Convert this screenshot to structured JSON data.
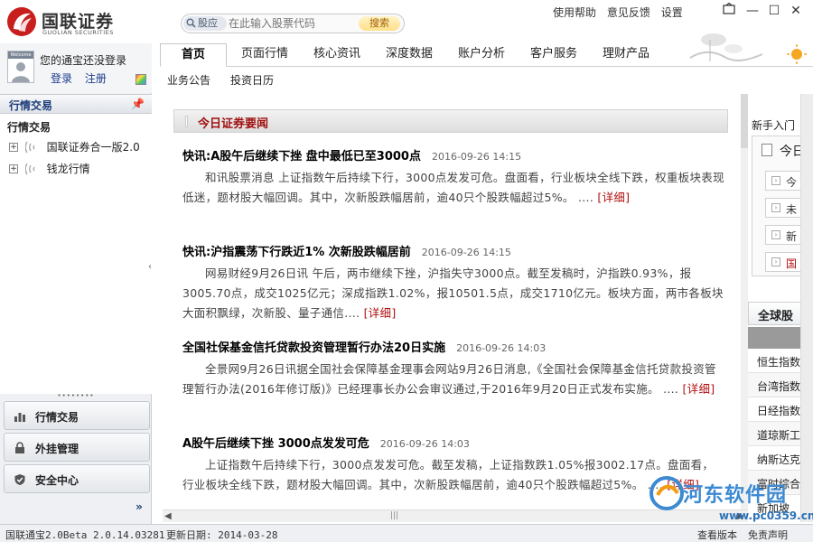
{
  "app": {
    "logo_name": "国联证券",
    "logo_sub": "GUOLIAN SECURITIES"
  },
  "search": {
    "type_label": "股应",
    "placeholder": "在此输入股票代码",
    "button_label": "搜索"
  },
  "top_links": [
    "使用帮助",
    "意见反馈",
    "设置"
  ],
  "window_controls": {
    "minimize": "—",
    "maximize": "☐",
    "close": "✕"
  },
  "user": {
    "avatar_text": "Welcome",
    "message": "您的通宝还没登录",
    "login": "登录",
    "register": "注册"
  },
  "left_panel": {
    "header": "行情交易",
    "tree_title": "行情交易",
    "tree_items": [
      {
        "label": "国联证券合一版2.0",
        "expander": "+"
      },
      {
        "label": "钱龙行情",
        "expander": "+"
      }
    ],
    "nav_buttons": [
      {
        "label": "行情交易",
        "icon": "bar-chart-icon"
      },
      {
        "label": "外挂管理",
        "icon": "lock-icon"
      },
      {
        "label": "安全中心",
        "icon": "shield-check-icon"
      }
    ],
    "more": "»"
  },
  "tabs": [
    "首页",
    "页面行情",
    "核心资讯",
    "深度数据",
    "账户分析",
    "客户服务",
    "理财产品"
  ],
  "active_tab": 0,
  "subtabs": [
    "业务公告",
    "投资日历"
  ],
  "section_title": "今日证券要闻",
  "news": [
    {
      "title": "快讯:A股午后继续下挫  盘中最低已至3000点",
      "time": "2016-09-26 14:15",
      "body": "和讯股票消息 上证指数午后持续下行，3000点发发可危。盘面看，行业板块全线下跌，权重板块表现低迷，题材股大幅回调。其中，次新股跌幅居前，逾40只个股跌幅超过5%。 ....",
      "more": "[详细]"
    },
    {
      "title": "快讯:沪指震荡下行跌近1% 次新股跌幅居前",
      "time": "2016-09-26 14:15",
      "body": "网易财经9月26日讯 午后，两市继续下挫，沪指失守3000点。截至发稿时，沪指跌0.93%，报3005.70点，成交1025亿元；深成指跌1.02%，报10501.5点，成交1710亿元。板块方面，两市各板块大面积飘绿，次新股、量子通信....",
      "more": "[详细]"
    },
    {
      "title": "全国社保基金信托贷款投资管理暂行办法20日实施",
      "time": "2016-09-26 14:03",
      "body": "全景网9月26日讯据全国社会保障基金理事会网站9月26日消息,《全国社会保障基金信托贷款投资管理暂行办法(2016年修订版)》已经理事长办公会审议通过,于2016年9月20日正式发布实施。 ....",
      "more": "[详细]"
    },
    {
      "title": "A股午后继续下挫  3000点发发可危",
      "time": "2016-09-26 14:03",
      "body": "上证指数午后持续下行，3000点发发可危。截至发稿，上证指数跌1.05%报3002.17点。盘面看，行业板块全线下跌，题材股大幅回调。其中，次新股跌幅居前，逾40只个股跌幅超过5%。 ....",
      "more": "[详细]"
    }
  ],
  "right_panel": {
    "title": "新手入门",
    "box_title": "今日",
    "box_items": [
      "今",
      "未",
      "新",
      "国"
    ],
    "global_title": "全球股",
    "indices": [
      "恒生指数",
      "台湾指数",
      "日经指数",
      "道琼斯工",
      "纳斯达克",
      "富时综合",
      "新加坡"
    ]
  },
  "watermark": {
    "name": "河东软件园",
    "url": "www.pc0359.cn"
  },
  "status": {
    "version": "国联通宝2.0Beta 2.0.14.03281",
    "update_date": "更新日期: 2014-03-28",
    "view_version": "查看版本",
    "disclaimer": "免责声明"
  }
}
